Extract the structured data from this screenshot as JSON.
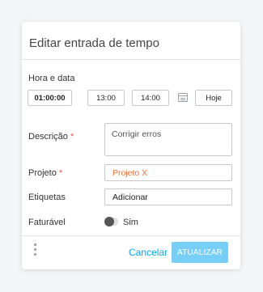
{
  "dialog": {
    "title": "Editar entrada de tempo"
  },
  "time_date": {
    "label": "Hora e data",
    "duration": "01:00:00",
    "start_time": "13:00",
    "end_time": "14:00",
    "date": "Hoje"
  },
  "description": {
    "label": "Descrição",
    "required_mark": "*",
    "value": "Corrigir erros"
  },
  "project": {
    "label": "Projeto",
    "required_mark": "*",
    "value": "Projeto X",
    "color": "#e8743b"
  },
  "tags": {
    "label": "Etiquetas",
    "value": "Adicionar"
  },
  "billable": {
    "label": "Faturável",
    "toggle_label": "Sim"
  },
  "footer": {
    "cancel_label": "Cancelar",
    "update_label": "ATUALIZAR"
  }
}
